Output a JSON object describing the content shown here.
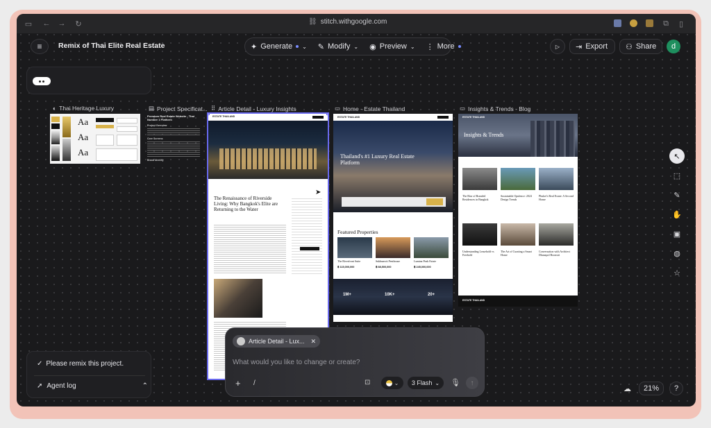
{
  "browser": {
    "url": "stitch.withgoogle.com"
  },
  "header": {
    "project_title": "Remix of Thai Elite Real Estate",
    "generate_label": "Generate",
    "modify_label": "Modify",
    "preview_label": "Preview",
    "more_label": "More",
    "export_label": "Export",
    "share_label": "Share",
    "avatar_letter": "d"
  },
  "frames": {
    "f1_label": "Thai Heritage Luxury",
    "f2_label": "Project Specificat...",
    "f3_label": "Article Detail - Luxury Insights",
    "f4_label": "Home - Estate Thailand",
    "f5_label": "Insights & Trends - Blog"
  },
  "style_sheet": {
    "aa1": "Aa",
    "aa2": "Aa",
    "aa3": "Aa"
  },
  "spec_doc": {
    "title": "Premium Real Estate Website - Thai Number 1 Platform",
    "overview_heading": "Project Overview",
    "core_heading": "Core Screens",
    "brand_heading": "Brand Identity"
  },
  "article": {
    "brand": "ESTATE THAILAND",
    "title": "The Renaissance of Riverside Living: Why Bangkok's Elite are Returning to the Water"
  },
  "home": {
    "brand": "ESTATE THAILAND",
    "hero_title": "Thailand's #1 Luxury Real Estate Platform",
    "featured_title": "Featured Properties",
    "p1_name": "The Riverfront Suite",
    "p1_price": "฿ 115,000,000",
    "p2_name": "Sukhumvit Penthouse",
    "p2_price": "฿ 88,500,000",
    "p3_name": "Lumina Peak Estate",
    "p3_price": "฿ 245,000,000",
    "stat1": "1M+",
    "stat2": "10K+",
    "stat3": "20+"
  },
  "blog": {
    "brand": "ESTATE THAILAND",
    "hero_title": "Insights & Trends",
    "c1": "The Rise of Branded Residences in Bangkok",
    "c2": "Sustainable Opulence: 2024 Design Trends",
    "c3": "Phuket's Real Estate: A Second Home",
    "c4": "Understanding Leasehold vs Freehold",
    "c5": "The Art of Curating a Smart Home",
    "c6": "Conversation with Architect Dhanapol Boonsiri",
    "footer_brand": "ESTATE THAILAND"
  },
  "chat": {
    "chip_label": "Article Detail - Lux...",
    "placeholder": "What would you like to change or create?",
    "slash": "/",
    "model_label": "3 Flash"
  },
  "sidebar_panel": {
    "remix_status": "Please remix this project.",
    "agent_log": "Agent log"
  },
  "zoom": {
    "level": "21%"
  },
  "colors": {
    "accent": "#7a8cff",
    "avatar": "#1e8f5e",
    "frame_outline": "#6a6af0",
    "gold": "#d8b24a"
  }
}
